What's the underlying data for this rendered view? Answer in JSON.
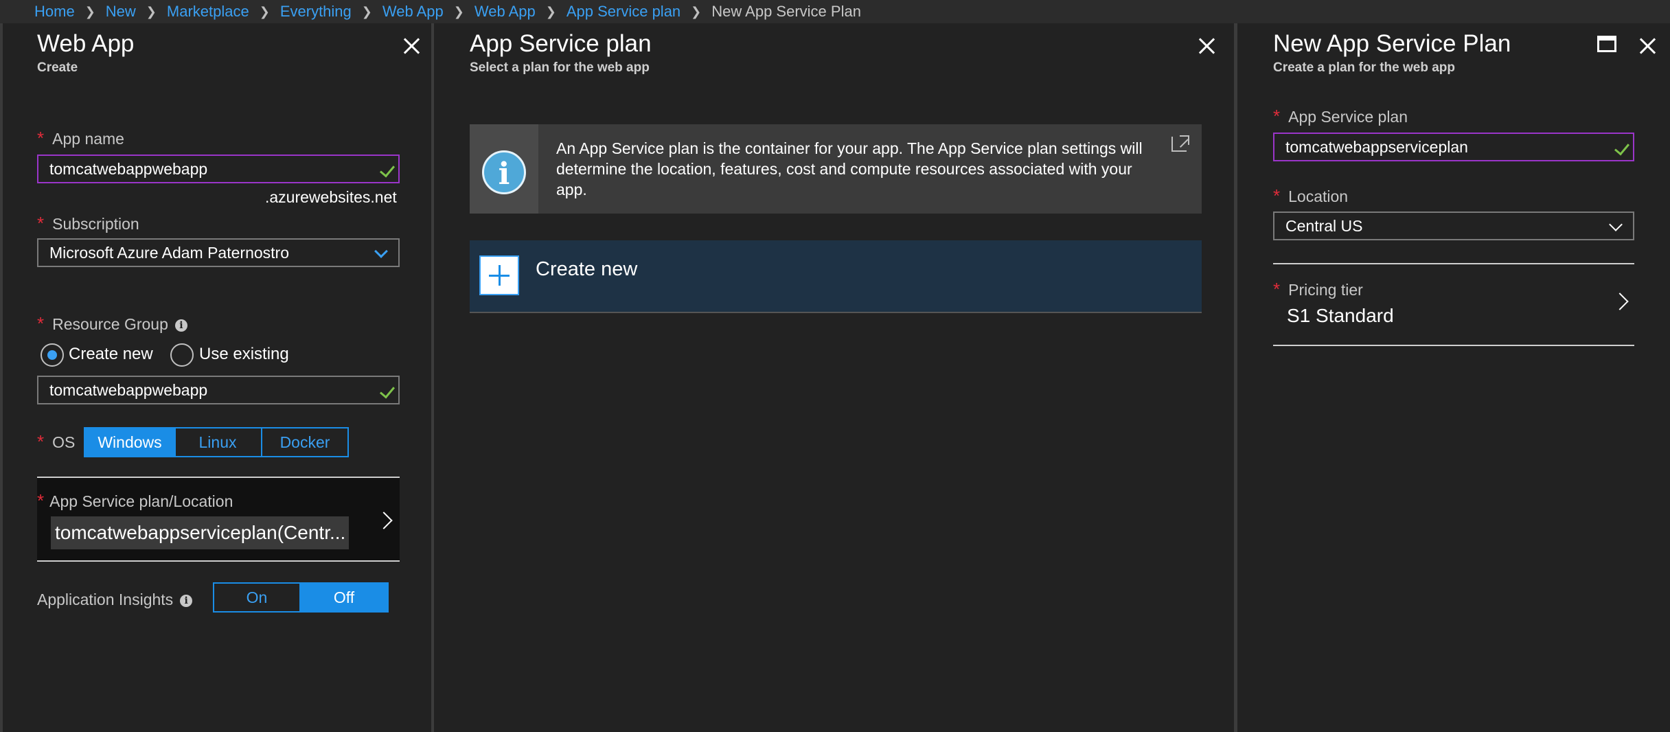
{
  "breadcrumb": [
    "Home",
    "New",
    "Marketplace",
    "Everything",
    "Web App",
    "Web App",
    "App Service plan"
  ],
  "breadcrumb_current": "New App Service Plan",
  "web_app": {
    "title": "Web App",
    "subtitle": "Create",
    "app_name_label": "App name",
    "app_name_value": "tomcatwebappwebapp",
    "domain_suffix": ".azurewebsites.net",
    "subscription_label": "Subscription",
    "subscription_value": "Microsoft Azure Adam Paternostro",
    "resource_group_label": "Resource Group",
    "rg_create_new": "Create new",
    "rg_use_existing": "Use existing",
    "resource_group_value": "tomcatwebappwebapp",
    "os_label": "OS",
    "os_options": [
      "Windows",
      "Linux",
      "Docker"
    ],
    "os_selected": "Windows",
    "plan_location_label": "App Service plan/Location",
    "plan_location_value": "tomcatwebappserviceplan(Centr...",
    "app_insights_label": "Application Insights",
    "app_insights_on": "On",
    "app_insights_off": "Off"
  },
  "app_service_plan": {
    "title": "App Service plan",
    "subtitle": "Select a plan for the web app",
    "info_text": "An App Service plan is the container for your app. The App Service plan settings will determine the location, features, cost and compute resources associated with your app.",
    "create_new_label": "Create new"
  },
  "new_plan": {
    "title": "New App Service Plan",
    "subtitle": "Create a plan for the web app",
    "plan_label": "App Service plan",
    "plan_value": "tomcatwebappserviceplan",
    "location_label": "Location",
    "location_value": "Central US",
    "pricing_label": "Pricing tier",
    "pricing_value": "S1 Standard"
  },
  "colors": {
    "accent": "#1a8de6",
    "link": "#3aa0f3",
    "required": "#e02c3a",
    "valid": "#7ec34a",
    "focus_border": "#9a35c9"
  }
}
